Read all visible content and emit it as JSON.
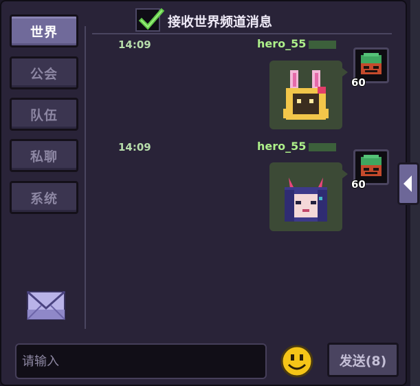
{
  "sidebar": {
    "tabs": [
      {
        "label": "世界",
        "active": true
      },
      {
        "label": "公会",
        "active": false
      },
      {
        "label": "队伍",
        "active": false
      },
      {
        "label": "私聊",
        "active": false
      },
      {
        "label": "系统",
        "active": false
      }
    ]
  },
  "header": {
    "receive_world_channel_label": "接收世界频道消息",
    "checked": true
  },
  "messages": [
    {
      "time": "14:09",
      "sender": "hero_55",
      "level": "60",
      "sticker": "bunny-hood-character"
    },
    {
      "time": "14:09",
      "sender": "hero_55",
      "level": "60",
      "sticker": "demon-horn-girl"
    }
  ],
  "input": {
    "placeholder": "请输入",
    "value": ""
  },
  "send_button": {
    "label": "发送(8)"
  },
  "colors": {
    "accent": "#706a9a",
    "sender_name": "#aef08a",
    "bubble": "#3c4a36"
  }
}
